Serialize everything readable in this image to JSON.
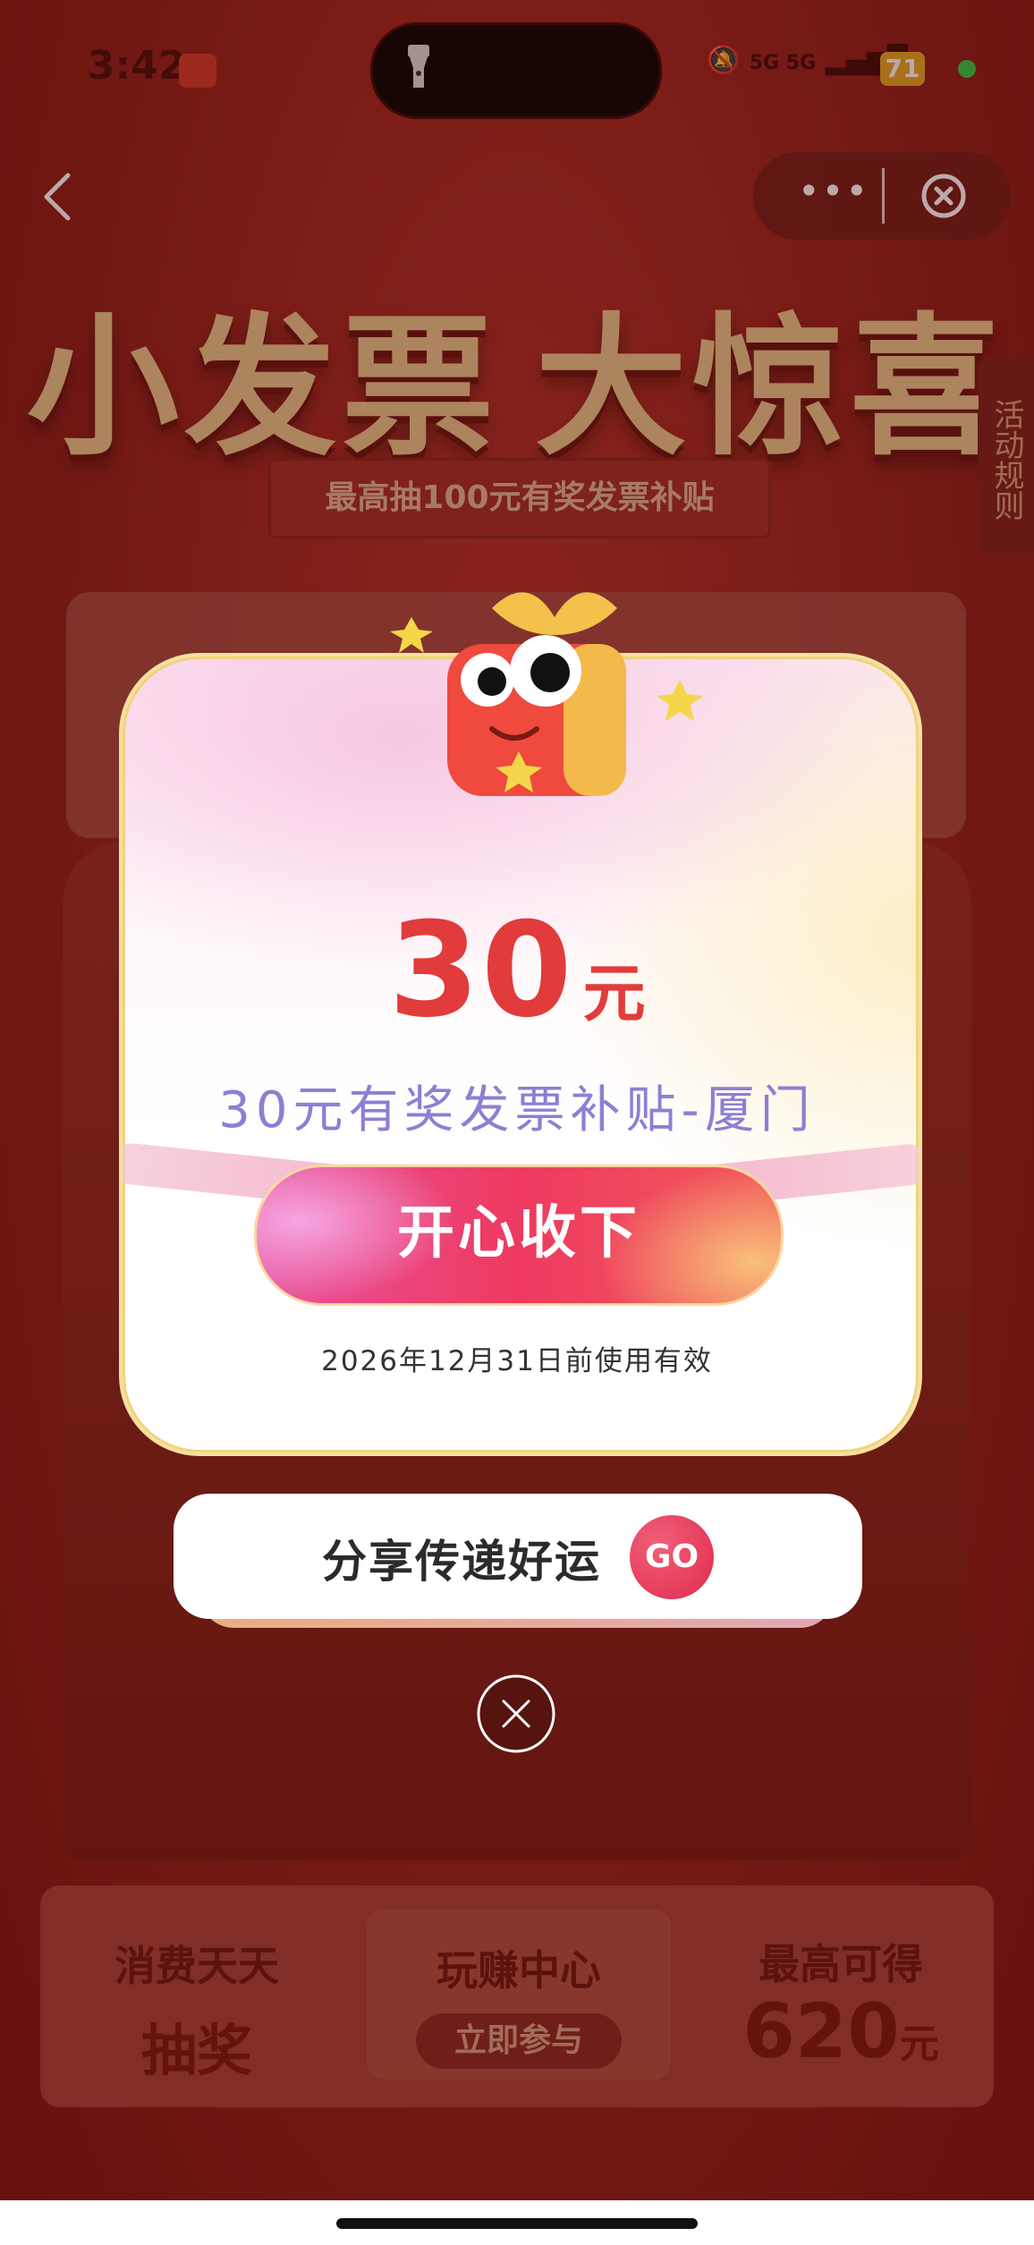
{
  "status_bar": {
    "time": "3:42",
    "network": "5G 5G",
    "battery": "71",
    "icons": [
      "flashlight-icon",
      "mute-icon",
      "signal-icon",
      "battery-icon"
    ]
  },
  "nav": {
    "back_icon": "chevron-left-icon",
    "more_label": "•••",
    "close_icon": "close-circle-icon"
  },
  "background": {
    "headline_part1": "小发票",
    "headline_part2": "大惊喜",
    "subhead": "最高抽100元有奖发票补贴",
    "rules_tab": "活动规则",
    "banner": {
      "left_line1": "消费天天",
      "left_line2": "抽奖",
      "mid_line1": "玩赚中心",
      "mid_button": "立即参与",
      "right_line1": "最高可得",
      "right_amount": "620",
      "right_unit": "元"
    }
  },
  "modal": {
    "amount": "30",
    "unit": "元",
    "prize_name": "30元有奖发票补贴-厦门",
    "accept_button": "开心收下",
    "expiry": "2026年12月31日前使用有效"
  },
  "share": {
    "text": "分享传递好运",
    "go_button": "GO"
  },
  "colors": {
    "accent_red": "#e23b3b",
    "prize_name_purple": "#8d7fd3",
    "button_pink": "#ee3a60"
  }
}
